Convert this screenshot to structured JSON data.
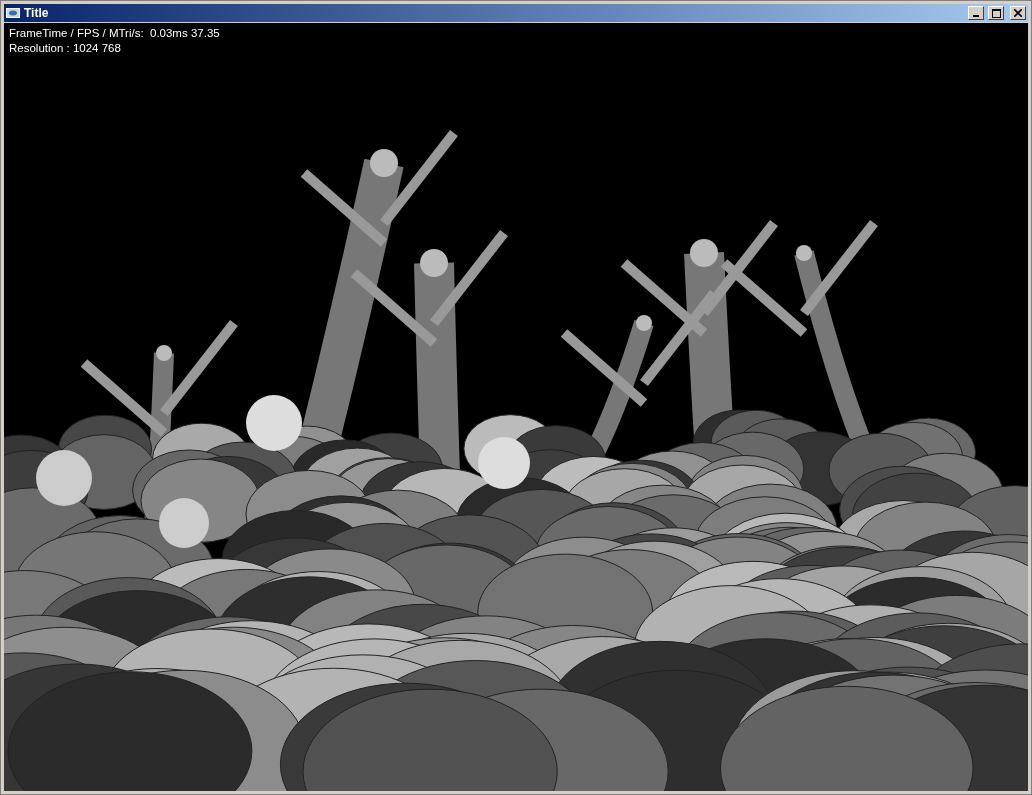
{
  "window": {
    "title": "Title"
  },
  "overlay": [
    "FrameTime / FPS / MTri/s:  0.03ms 37.35",
    "Resolution : 1024 768"
  ]
}
